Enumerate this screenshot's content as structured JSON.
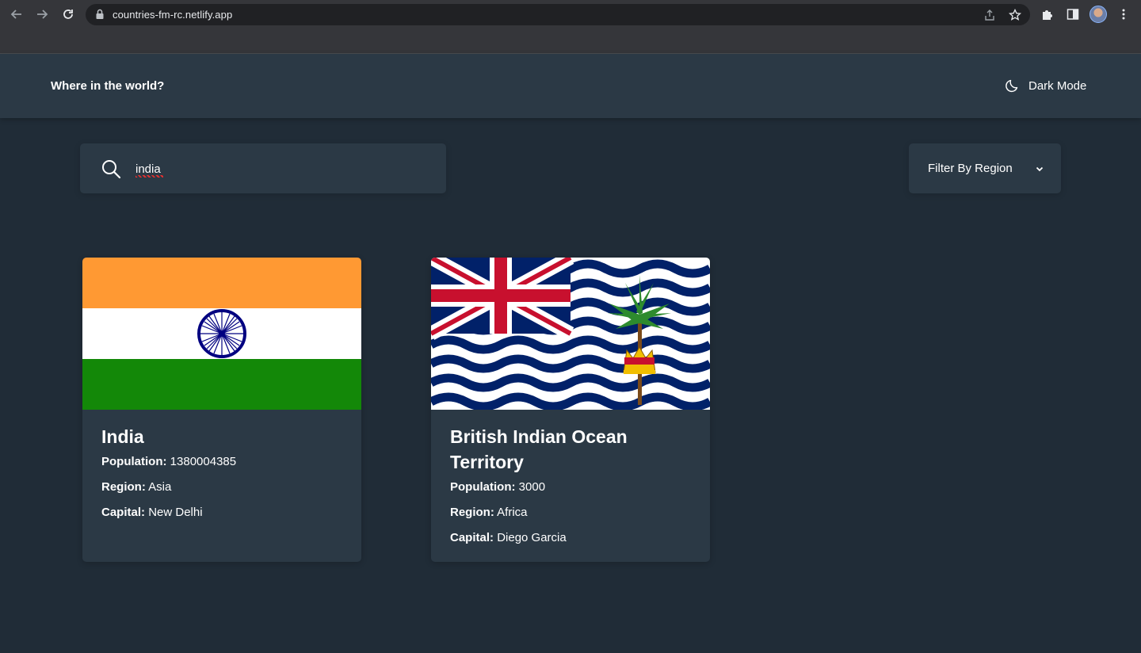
{
  "browser": {
    "url": "countries-fm-rc.netlify.app"
  },
  "header": {
    "title": "Where in the world?",
    "theme_toggle_label": "Dark Mode"
  },
  "search": {
    "value": "india"
  },
  "filter": {
    "label": "Filter By Region"
  },
  "labels": {
    "population": "Population:",
    "region": "Region:",
    "capital": "Capital:"
  },
  "countries": [
    {
      "name": "India",
      "population": "1380004385",
      "region": "Asia",
      "capital": "New Delhi"
    },
    {
      "name": "British Indian Ocean Territory",
      "population": "3000",
      "region": "Africa",
      "capital": "Diego Garcia"
    }
  ],
  "colors": {
    "background": "#202c37",
    "element": "#2b3945",
    "text": "#ffffff"
  }
}
